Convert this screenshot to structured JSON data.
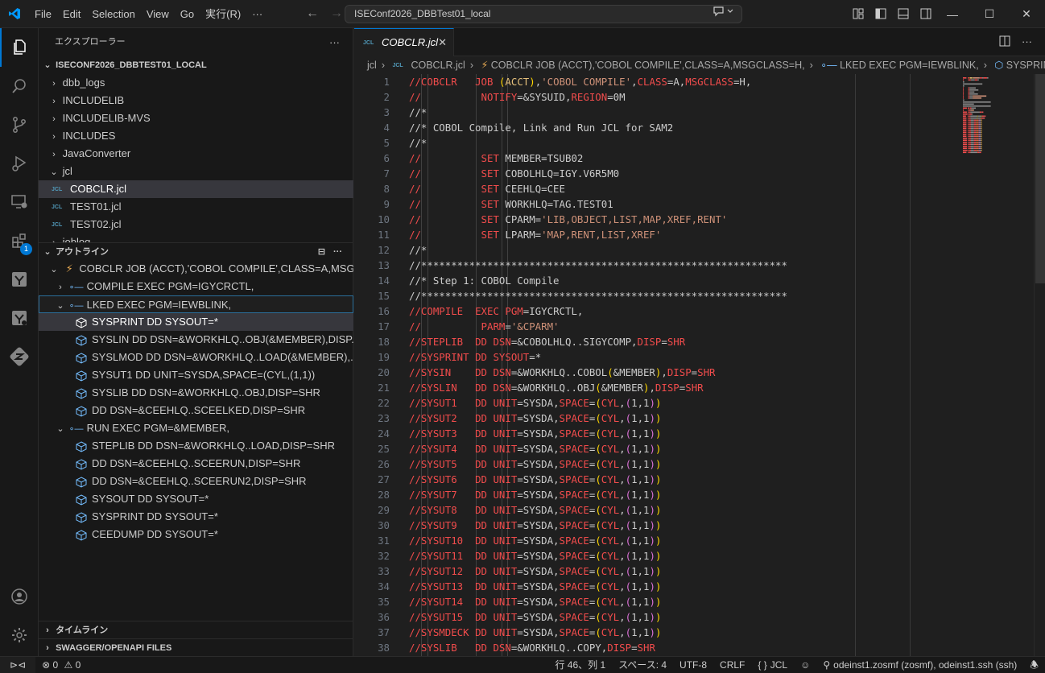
{
  "menu": [
    "File",
    "Edit",
    "Selection",
    "View",
    "Go",
    "実行(R)",
    "···"
  ],
  "command_center": "ISEConf2026_DBBTest01_local",
  "explorer": {
    "title": "エクスプローラー",
    "root": "ISECONF2026_DBBTEST01_LOCAL",
    "items": [
      {
        "label": "dbb_logs",
        "type": "folder"
      },
      {
        "label": "INCLUDELIB",
        "type": "folder"
      },
      {
        "label": "INCLUDELIB-MVS",
        "type": "folder"
      },
      {
        "label": "INCLUDES",
        "type": "folder"
      },
      {
        "label": "JavaConverter",
        "type": "folder"
      },
      {
        "label": "jcl",
        "type": "folder-open"
      },
      {
        "label": "COBCLR.jcl",
        "type": "file",
        "selected": true
      },
      {
        "label": "TEST01.jcl",
        "type": "file"
      },
      {
        "label": "TEST02.jcl",
        "type": "file"
      },
      {
        "label": "joblog",
        "type": "folder"
      }
    ]
  },
  "outline": {
    "title": "アウトライン",
    "job": "COBCLR  JOB (ACCT),'COBOL COMPILE',CLASS=A,MSGCL...",
    "compile": "COMPILE  EXEC PGM=IGYCRCTL,",
    "lked": "LKED     EXEC PGM=IEWBLINK,",
    "lked_children": [
      "SYSPRINT DD SYSOUT=*",
      "SYSLIN   DD DSN=&WORKHLQ..OBJ(&MEMBER),DISP...",
      "SYSLMOD  DD DSN=&WORKHLQ..LOAD(&MEMBER),...",
      "SYSUT1   DD UNIT=SYSDA,SPACE=(CYL,(1,1))",
      "SYSLIB   DD DSN=&WORKHLQ..OBJ,DISP=SHR",
      "DD DSN=&CEEHLQ..SCEELKED,DISP=SHR"
    ],
    "run": "RUN      EXEC PGM=&MEMBER,",
    "run_children": [
      "STEPLIB  DD DSN=&WORKHLQ..LOAD,DISP=SHR",
      "DD DSN=&CEEHLQ..SCEERUN,DISP=SHR",
      "DD DSN=&CEEHLQ..SCEERUN2,DISP=SHR",
      "SYSOUT   DD SYSOUT=*",
      "SYSPRINT DD SYSOUT=*",
      "CEEDUMP  DD SYSOUT=*"
    ]
  },
  "timeline": "タイムライン",
  "swagger": "SWAGGER/OPENAPI FILES",
  "tab": {
    "badge": "JCL",
    "label": "COBCLR.jcl"
  },
  "breadcrumb": [
    "jcl",
    "COBCLR.jcl",
    "COBCLR  JOB (ACCT),'COBOL COMPILE',CLASS=A,MSGCLASS=H,",
    "LKED     EXEC PGM=IEWBLINK,",
    "SYSPRINT DD"
  ],
  "code_lines": [
    [
      [
        "k",
        "//COBCLR"
      ],
      [
        "c",
        "   "
      ],
      [
        "k",
        "JOB"
      ],
      [
        "c",
        " "
      ],
      [
        "p",
        "("
      ],
      [
        "y",
        "ACCT"
      ],
      [
        "p",
        ")"
      ],
      [
        "c",
        ","
      ],
      [
        "s",
        "'COBOL COMPILE'"
      ],
      [
        "c",
        ","
      ],
      [
        "k",
        "CLASS"
      ],
      [
        "c",
        "=A,"
      ],
      [
        "k",
        "MSGCLASS"
      ],
      [
        "c",
        "=H,"
      ]
    ],
    [
      [
        "k",
        "//"
      ],
      [
        "c",
        "          "
      ],
      [
        "k",
        "NOTIFY"
      ],
      [
        "c",
        "=&SYSUID,"
      ],
      [
        "k",
        "REGION"
      ],
      [
        "c",
        "=0M"
      ]
    ],
    [
      [
        "c",
        "//*"
      ]
    ],
    [
      [
        "c",
        "//* COBOL Compile, Link and Run JCL for SAM2"
      ]
    ],
    [
      [
        "c",
        "//*"
      ]
    ],
    [
      [
        "k",
        "//"
      ],
      [
        "c",
        "          "
      ],
      [
        "k",
        "SET"
      ],
      [
        "c",
        " MEMBER=TSUB02"
      ]
    ],
    [
      [
        "k",
        "//"
      ],
      [
        "c",
        "          "
      ],
      [
        "k",
        "SET"
      ],
      [
        "c",
        " COBOLHLQ=IGY.V6R5M0"
      ]
    ],
    [
      [
        "k",
        "//"
      ],
      [
        "c",
        "          "
      ],
      [
        "k",
        "SET"
      ],
      [
        "c",
        " CEEHLQ=CEE"
      ]
    ],
    [
      [
        "k",
        "//"
      ],
      [
        "c",
        "          "
      ],
      [
        "k",
        "SET"
      ],
      [
        "c",
        " WORKHLQ=TAG.TEST01"
      ]
    ],
    [
      [
        "k",
        "//"
      ],
      [
        "c",
        "          "
      ],
      [
        "k",
        "SET"
      ],
      [
        "c",
        " CPARM="
      ],
      [
        "s",
        "'LIB,OBJECT,LIST,MAP,XREF,RENT'"
      ]
    ],
    [
      [
        "k",
        "//"
      ],
      [
        "c",
        "          "
      ],
      [
        "k",
        "SET"
      ],
      [
        "c",
        " LPARM="
      ],
      [
        "s",
        "'MAP,RENT,LIST,XREF'"
      ]
    ],
    [
      [
        "c",
        "//*"
      ]
    ],
    [
      [
        "c",
        "//*************************************************************"
      ]
    ],
    [
      [
        "c",
        "//* Step 1: COBOL Compile"
      ]
    ],
    [
      [
        "c",
        "//*************************************************************"
      ]
    ],
    [
      [
        "k",
        "//COMPILE"
      ],
      [
        "c",
        "  "
      ],
      [
        "k",
        "EXEC"
      ],
      [
        "c",
        " "
      ],
      [
        "k",
        "PGM"
      ],
      [
        "c",
        "=IGYCRCTL,"
      ]
    ],
    [
      [
        "k",
        "//"
      ],
      [
        "c",
        "          "
      ],
      [
        "k",
        "PARM"
      ],
      [
        "c",
        "="
      ],
      [
        "s",
        "'&CPARM'"
      ]
    ],
    [
      [
        "k",
        "//STEPLIB"
      ],
      [
        "c",
        "  "
      ],
      [
        "k",
        "DD"
      ],
      [
        "c",
        " "
      ],
      [
        "k",
        "DSN"
      ],
      [
        "c",
        "=&COBOLHLQ..SIGYCOMP,"
      ],
      [
        "k",
        "DISP"
      ],
      [
        "c",
        "="
      ],
      [
        "k",
        "SHR"
      ]
    ],
    [
      [
        "k",
        "//SYSPRINT"
      ],
      [
        "c",
        " "
      ],
      [
        "k",
        "DD"
      ],
      [
        "c",
        " "
      ],
      [
        "k",
        "SYSOUT"
      ],
      [
        "c",
        "=*"
      ]
    ],
    [
      [
        "k",
        "//SYSIN"
      ],
      [
        "c",
        "    "
      ],
      [
        "k",
        "DD"
      ],
      [
        "c",
        " "
      ],
      [
        "k",
        "DSN"
      ],
      [
        "c",
        "=&WORKHLQ..COBOL"
      ],
      [
        "p",
        "("
      ],
      [
        "c",
        "&MEMBER"
      ],
      [
        "p",
        ")"
      ],
      [
        "c",
        ","
      ],
      [
        "k",
        "DISP"
      ],
      [
        "c",
        "="
      ],
      [
        "k",
        "SHR"
      ]
    ],
    [
      [
        "k",
        "//SYSLIN"
      ],
      [
        "c",
        "   "
      ],
      [
        "k",
        "DD"
      ],
      [
        "c",
        " "
      ],
      [
        "k",
        "DSN"
      ],
      [
        "c",
        "=&WORKHLQ..OBJ"
      ],
      [
        "p",
        "("
      ],
      [
        "c",
        "&MEMBER"
      ],
      [
        "p",
        ")"
      ],
      [
        "c",
        ","
      ],
      [
        "k",
        "DISP"
      ],
      [
        "c",
        "="
      ],
      [
        "k",
        "SHR"
      ]
    ],
    [
      [
        "k",
        "//SYSUT1"
      ],
      [
        "c",
        "   "
      ],
      [
        "k",
        "DD"
      ],
      [
        "c",
        " "
      ],
      [
        "k",
        "UNIT"
      ],
      [
        "c",
        "=SYSDA,"
      ],
      [
        "k",
        "SPACE"
      ],
      [
        "c",
        "="
      ],
      [
        "p",
        "("
      ],
      [
        "k",
        "CYL"
      ],
      [
        "c",
        ","
      ],
      [
        "pk",
        "("
      ],
      [
        "c",
        "1,1"
      ],
      [
        "pk",
        ")"
      ],
      [
        "p",
        ")"
      ]
    ],
    [
      [
        "k",
        "//SYSUT2"
      ],
      [
        "c",
        "   "
      ],
      [
        "k",
        "DD"
      ],
      [
        "c",
        " "
      ],
      [
        "k",
        "UNIT"
      ],
      [
        "c",
        "=SYSDA,"
      ],
      [
        "k",
        "SPACE"
      ],
      [
        "c",
        "="
      ],
      [
        "p",
        "("
      ],
      [
        "k",
        "CYL"
      ],
      [
        "c",
        ","
      ],
      [
        "pk",
        "("
      ],
      [
        "c",
        "1,1"
      ],
      [
        "pk",
        ")"
      ],
      [
        "p",
        ")"
      ]
    ],
    [
      [
        "k",
        "//SYSUT3"
      ],
      [
        "c",
        "   "
      ],
      [
        "k",
        "DD"
      ],
      [
        "c",
        " "
      ],
      [
        "k",
        "UNIT"
      ],
      [
        "c",
        "=SYSDA,"
      ],
      [
        "k",
        "SPACE"
      ],
      [
        "c",
        "="
      ],
      [
        "p",
        "("
      ],
      [
        "k",
        "CYL"
      ],
      [
        "c",
        ","
      ],
      [
        "pk",
        "("
      ],
      [
        "c",
        "1,1"
      ],
      [
        "pk",
        ")"
      ],
      [
        "p",
        ")"
      ]
    ],
    [
      [
        "k",
        "//SYSUT4"
      ],
      [
        "c",
        "   "
      ],
      [
        "k",
        "DD"
      ],
      [
        "c",
        " "
      ],
      [
        "k",
        "UNIT"
      ],
      [
        "c",
        "=SYSDA,"
      ],
      [
        "k",
        "SPACE"
      ],
      [
        "c",
        "="
      ],
      [
        "p",
        "("
      ],
      [
        "k",
        "CYL"
      ],
      [
        "c",
        ","
      ],
      [
        "pk",
        "("
      ],
      [
        "c",
        "1,1"
      ],
      [
        "pk",
        ")"
      ],
      [
        "p",
        ")"
      ]
    ],
    [
      [
        "k",
        "//SYSUT5"
      ],
      [
        "c",
        "   "
      ],
      [
        "k",
        "DD"
      ],
      [
        "c",
        " "
      ],
      [
        "k",
        "UNIT"
      ],
      [
        "c",
        "=SYSDA,"
      ],
      [
        "k",
        "SPACE"
      ],
      [
        "c",
        "="
      ],
      [
        "p",
        "("
      ],
      [
        "k",
        "CYL"
      ],
      [
        "c",
        ","
      ],
      [
        "pk",
        "("
      ],
      [
        "c",
        "1,1"
      ],
      [
        "pk",
        ")"
      ],
      [
        "p",
        ")"
      ]
    ],
    [
      [
        "k",
        "//SYSUT6"
      ],
      [
        "c",
        "   "
      ],
      [
        "k",
        "DD"
      ],
      [
        "c",
        " "
      ],
      [
        "k",
        "UNIT"
      ],
      [
        "c",
        "=SYSDA,"
      ],
      [
        "k",
        "SPACE"
      ],
      [
        "c",
        "="
      ],
      [
        "p",
        "("
      ],
      [
        "k",
        "CYL"
      ],
      [
        "c",
        ","
      ],
      [
        "pk",
        "("
      ],
      [
        "c",
        "1,1"
      ],
      [
        "pk",
        ")"
      ],
      [
        "p",
        ")"
      ]
    ],
    [
      [
        "k",
        "//SYSUT7"
      ],
      [
        "c",
        "   "
      ],
      [
        "k",
        "DD"
      ],
      [
        "c",
        " "
      ],
      [
        "k",
        "UNIT"
      ],
      [
        "c",
        "=SYSDA,"
      ],
      [
        "k",
        "SPACE"
      ],
      [
        "c",
        "="
      ],
      [
        "p",
        "("
      ],
      [
        "k",
        "CYL"
      ],
      [
        "c",
        ","
      ],
      [
        "pk",
        "("
      ],
      [
        "c",
        "1,1"
      ],
      [
        "pk",
        ")"
      ],
      [
        "p",
        ")"
      ]
    ],
    [
      [
        "k",
        "//SYSUT8"
      ],
      [
        "c",
        "   "
      ],
      [
        "k",
        "DD"
      ],
      [
        "c",
        " "
      ],
      [
        "k",
        "UNIT"
      ],
      [
        "c",
        "=SYSDA,"
      ],
      [
        "k",
        "SPACE"
      ],
      [
        "c",
        "="
      ],
      [
        "p",
        "("
      ],
      [
        "k",
        "CYL"
      ],
      [
        "c",
        ","
      ],
      [
        "pk",
        "("
      ],
      [
        "c",
        "1,1"
      ],
      [
        "pk",
        ")"
      ],
      [
        "p",
        ")"
      ]
    ],
    [
      [
        "k",
        "//SYSUT9"
      ],
      [
        "c",
        "   "
      ],
      [
        "k",
        "DD"
      ],
      [
        "c",
        " "
      ],
      [
        "k",
        "UNIT"
      ],
      [
        "c",
        "=SYSDA,"
      ],
      [
        "k",
        "SPACE"
      ],
      [
        "c",
        "="
      ],
      [
        "p",
        "("
      ],
      [
        "k",
        "CYL"
      ],
      [
        "c",
        ","
      ],
      [
        "pk",
        "("
      ],
      [
        "c",
        "1,1"
      ],
      [
        "pk",
        ")"
      ],
      [
        "p",
        ")"
      ]
    ],
    [
      [
        "k",
        "//SYSUT10"
      ],
      [
        "c",
        "  "
      ],
      [
        "k",
        "DD"
      ],
      [
        "c",
        " "
      ],
      [
        "k",
        "UNIT"
      ],
      [
        "c",
        "=SYSDA,"
      ],
      [
        "k",
        "SPACE"
      ],
      [
        "c",
        "="
      ],
      [
        "p",
        "("
      ],
      [
        "k",
        "CYL"
      ],
      [
        "c",
        ","
      ],
      [
        "pk",
        "("
      ],
      [
        "c",
        "1,1"
      ],
      [
        "pk",
        ")"
      ],
      [
        "p",
        ")"
      ]
    ],
    [
      [
        "k",
        "//SYSUT11"
      ],
      [
        "c",
        "  "
      ],
      [
        "k",
        "DD"
      ],
      [
        "c",
        " "
      ],
      [
        "k",
        "UNIT"
      ],
      [
        "c",
        "=SYSDA,"
      ],
      [
        "k",
        "SPACE"
      ],
      [
        "c",
        "="
      ],
      [
        "p",
        "("
      ],
      [
        "k",
        "CYL"
      ],
      [
        "c",
        ","
      ],
      [
        "pk",
        "("
      ],
      [
        "c",
        "1,1"
      ],
      [
        "pk",
        ")"
      ],
      [
        "p",
        ")"
      ]
    ],
    [
      [
        "k",
        "//SYSUT12"
      ],
      [
        "c",
        "  "
      ],
      [
        "k",
        "DD"
      ],
      [
        "c",
        " "
      ],
      [
        "k",
        "UNIT"
      ],
      [
        "c",
        "=SYSDA,"
      ],
      [
        "k",
        "SPACE"
      ],
      [
        "c",
        "="
      ],
      [
        "p",
        "("
      ],
      [
        "k",
        "CYL"
      ],
      [
        "c",
        ","
      ],
      [
        "pk",
        "("
      ],
      [
        "c",
        "1,1"
      ],
      [
        "pk",
        ")"
      ],
      [
        "p",
        ")"
      ]
    ],
    [
      [
        "k",
        "//SYSUT13"
      ],
      [
        "c",
        "  "
      ],
      [
        "k",
        "DD"
      ],
      [
        "c",
        " "
      ],
      [
        "k",
        "UNIT"
      ],
      [
        "c",
        "=SYSDA,"
      ],
      [
        "k",
        "SPACE"
      ],
      [
        "c",
        "="
      ],
      [
        "p",
        "("
      ],
      [
        "k",
        "CYL"
      ],
      [
        "c",
        ","
      ],
      [
        "pk",
        "("
      ],
      [
        "c",
        "1,1"
      ],
      [
        "pk",
        ")"
      ],
      [
        "p",
        ")"
      ]
    ],
    [
      [
        "k",
        "//SYSUT14"
      ],
      [
        "c",
        "  "
      ],
      [
        "k",
        "DD"
      ],
      [
        "c",
        " "
      ],
      [
        "k",
        "UNIT"
      ],
      [
        "c",
        "=SYSDA,"
      ],
      [
        "k",
        "SPACE"
      ],
      [
        "c",
        "="
      ],
      [
        "p",
        "("
      ],
      [
        "k",
        "CYL"
      ],
      [
        "c",
        ","
      ],
      [
        "pk",
        "("
      ],
      [
        "c",
        "1,1"
      ],
      [
        "pk",
        ")"
      ],
      [
        "p",
        ")"
      ]
    ],
    [
      [
        "k",
        "//SYSUT15"
      ],
      [
        "c",
        "  "
      ],
      [
        "k",
        "DD"
      ],
      [
        "c",
        " "
      ],
      [
        "k",
        "UNIT"
      ],
      [
        "c",
        "=SYSDA,"
      ],
      [
        "k",
        "SPACE"
      ],
      [
        "c",
        "="
      ],
      [
        "p",
        "("
      ],
      [
        "k",
        "CYL"
      ],
      [
        "c",
        ","
      ],
      [
        "pk",
        "("
      ],
      [
        "c",
        "1,1"
      ],
      [
        "pk",
        ")"
      ],
      [
        "p",
        ")"
      ]
    ],
    [
      [
        "k",
        "//SYSMDECK"
      ],
      [
        "c",
        " "
      ],
      [
        "k",
        "DD"
      ],
      [
        "c",
        " "
      ],
      [
        "k",
        "UNIT"
      ],
      [
        "c",
        "=SYSDA,"
      ],
      [
        "k",
        "SPACE"
      ],
      [
        "c",
        "="
      ],
      [
        "p",
        "("
      ],
      [
        "k",
        "CYL"
      ],
      [
        "c",
        ","
      ],
      [
        "pk",
        "("
      ],
      [
        "c",
        "1,1"
      ],
      [
        "pk",
        ")"
      ],
      [
        "p",
        ")"
      ]
    ],
    [
      [
        "k",
        "//SYSLIB"
      ],
      [
        "c",
        "   "
      ],
      [
        "k",
        "DD"
      ],
      [
        "c",
        " "
      ],
      [
        "k",
        "DSN"
      ],
      [
        "c",
        "=&WORKHLQ..COPY,"
      ],
      [
        "k",
        "DISP"
      ],
      [
        "c",
        "="
      ],
      [
        "k",
        "SHR"
      ]
    ]
  ],
  "status": {
    "errors": "0",
    "warnings": "0",
    "position": "行 46、列 1",
    "spaces": "スペース: 4",
    "encoding": "UTF-8",
    "eol": "CRLF",
    "language": "JCL",
    "language_prefix": "{ }",
    "remote": "odeinst1.zosmf (zosmf), odeinst1.ssh (ssh)"
  },
  "extensions_badge": "1",
  "colors": {
    "accent": "#0078d4",
    "keyword": "#f14c4c",
    "string": "#ce9178",
    "bracket": "#ffd700"
  }
}
